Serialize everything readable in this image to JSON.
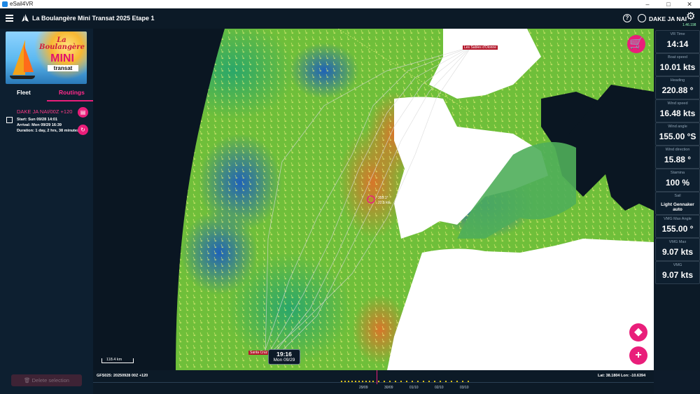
{
  "window": {
    "title": "eSail4VR"
  },
  "header": {
    "race_title": "La Boulangère Mini Transat 2025 Etape 1",
    "user_name": "DAKE JA NAI",
    "version": "1.46.198"
  },
  "sidebar": {
    "promo": {
      "brand": "La Boulangère",
      "mini": "MINI",
      "transat": "transat"
    },
    "tabs": {
      "fleet": "Fleet",
      "routings": "Routings"
    },
    "route": {
      "name": "DAKE JA NAI/00Z +120",
      "start": "Start: Sun 09/28 14:01",
      "arrival": "Arrival: Mon 09/29 16:39",
      "duration": "Duration: 1 day, 2 hrs, 38 minutes"
    },
    "delete_label": "Delete selection"
  },
  "stats": [
    {
      "label": "VR Time",
      "value": "14:14"
    },
    {
      "label": "Boat speed",
      "value": "10.01 kts"
    },
    {
      "label": "Heading",
      "value": "220.88 °"
    },
    {
      "label": "Wind speed",
      "value": "16.48 kts"
    },
    {
      "label": "Wind angle",
      "value": "155.00 °S"
    },
    {
      "label": "Wind direction",
      "value": "15.88 °"
    },
    {
      "label": "Stamina",
      "value": "100 %"
    },
    {
      "label": "Sail",
      "value": "Light Gennaker auto"
    },
    {
      "label": "VMG Max Angle",
      "value": "155.00 °"
    },
    {
      "label": "VMG Max",
      "value": "9.07 kts"
    },
    {
      "label": "VMG",
      "value": "9.07 kts"
    }
  ],
  "map": {
    "start_label": "Les Sables d'Olonne",
    "finish_label": "Santa Cruz de La Palma",
    "boat_readout_1": "355.1°",
    "boat_readout_2": "22.5 kts",
    "scale_label": "118.4 km"
  },
  "timeline": {
    "model": "GFS025: 20250928 00Z +120",
    "latlon": "Lat: 38.1804 Lon: -10.6394",
    "cursor_time": "19:16",
    "cursor_date": "Mon 09/29",
    "dates": [
      "29/09",
      "30/09",
      "01/10",
      "02/10",
      "03/10"
    ]
  },
  "colors": {
    "accent": "#e91e7a",
    "panel": "#0c1a27",
    "land": "#ffffff"
  }
}
